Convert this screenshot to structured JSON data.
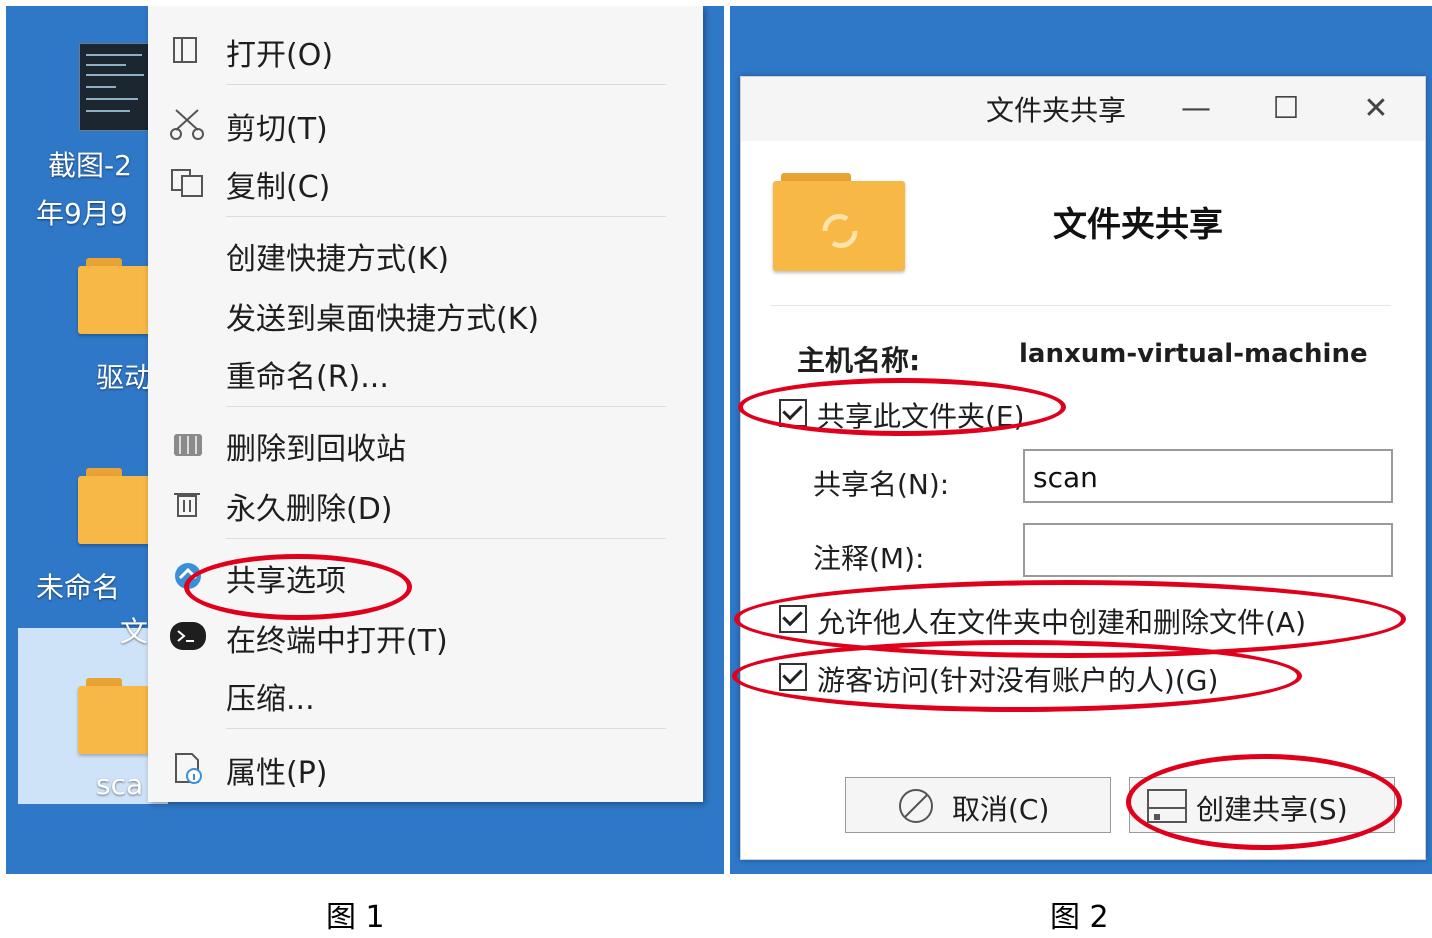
{
  "figure1": {
    "desktop_labels": [
      "截图-2",
      "年9月9",
      "驱动",
      "未命名",
      "文",
      "sca"
    ],
    "menu_items": [
      {
        "icon": "open-icon",
        "label": "打开(O)"
      },
      {
        "icon": "cut-icon",
        "label": "剪切(T)"
      },
      {
        "icon": "copy-icon",
        "label": "复制(C)"
      },
      {
        "icon": "",
        "label": "创建快捷方式(K)"
      },
      {
        "icon": "",
        "label": "发送到桌面快捷方式(K)"
      },
      {
        "icon": "",
        "label": "重命名(R)..."
      },
      {
        "icon": "trash-icon",
        "label": "删除到回收站"
      },
      {
        "icon": "delete-icon",
        "label": "永久删除(D)"
      },
      {
        "icon": "share-icon",
        "label": "共享选项"
      },
      {
        "icon": "terminal-icon",
        "label": "在终端中打开(T)"
      },
      {
        "icon": "",
        "label": "压缩..."
      },
      {
        "icon": "properties-icon",
        "label": "属性(P)"
      }
    ],
    "caption": "图 1"
  },
  "figure2": {
    "window_title": "文件夹共享",
    "heading": "文件夹共享",
    "host_label": "主机名称:",
    "host_value": "lanxum-virtual-machine",
    "share_folder_label": "共享此文件夹(E)",
    "share_folder_checked": true,
    "share_name_label": "共享名(N):",
    "share_name_value": "scan",
    "comment_label": "注释(M):",
    "comment_value": "",
    "allow_create_delete_label": "允许他人在文件夹中创建和删除文件(A)",
    "allow_create_delete_checked": true,
    "guest_access_label": "游客访问(针对没有账户的人)(G)",
    "guest_access_checked": true,
    "cancel_label": "取消(C)",
    "create_share_label": "创建共享(S)",
    "caption": "图 2"
  },
  "colors": {
    "desktop_bg": "#2f78c8",
    "annotation_ring": "#e0001b",
    "folder": "#f7b846"
  }
}
